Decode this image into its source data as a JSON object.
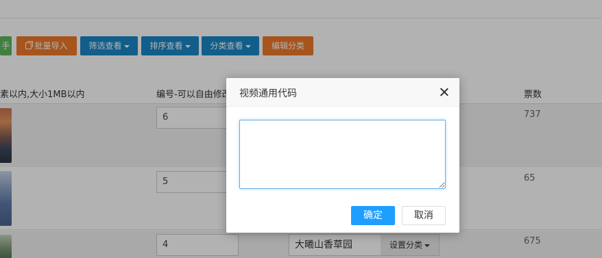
{
  "toolbar": {
    "partial_label": "手",
    "import_label": "批量导入",
    "filter_label": "筛选查看",
    "sort_label": "排序查看",
    "category_label": "分类查看",
    "edit_category_label": "编辑分类"
  },
  "table": {
    "headers": {
      "image": "素以内,大小1MB以内",
      "number": "编号-可以自由修改",
      "votes": "票数"
    },
    "rows": [
      {
        "number": "6",
        "votes": "737"
      },
      {
        "number": "5",
        "votes": "65"
      },
      {
        "number": "4",
        "name": "大曦山香草园",
        "category_button": "设置分类",
        "votes": "675"
      }
    ]
  },
  "modal": {
    "title": "视频通用代码",
    "textarea_value": "",
    "confirm_label": "确定",
    "cancel_label": "取消"
  },
  "colors": {
    "primary_blue": "#1e9fff",
    "toolbar_blue": "#1a87c6",
    "toolbar_orange": "#f0792a",
    "toolbar_green": "#5cb85c"
  }
}
